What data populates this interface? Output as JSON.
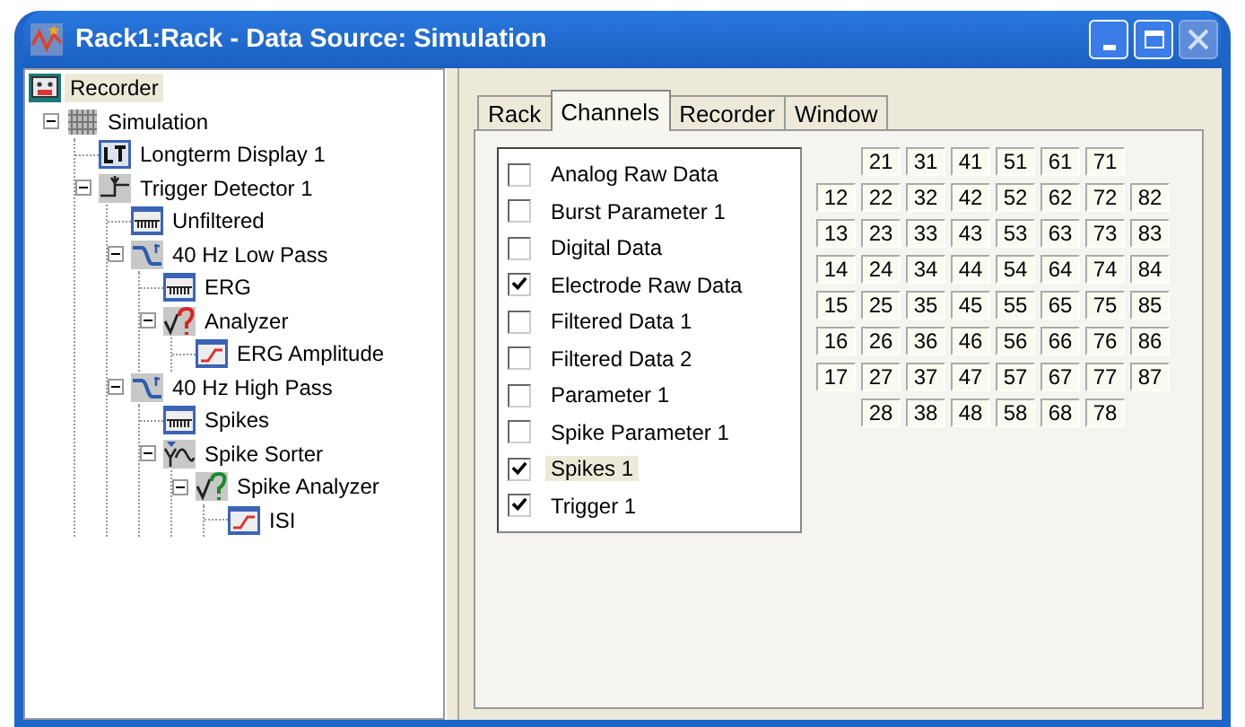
{
  "window": {
    "title": "Rack1:Rack - Data Source: Simulation",
    "buttons": [
      {
        "kind": "minimize",
        "disabled": false
      },
      {
        "kind": "maximize",
        "disabled": false
      },
      {
        "kind": "close",
        "disabled": true
      }
    ]
  },
  "tree": [
    {
      "label": "Recorder",
      "kind": "recorder",
      "selected": true,
      "children": [
        {
          "label": "Simulation",
          "kind": "simulation",
          "selected": false,
          "expanded": true,
          "children": [
            {
              "label": "Longterm Display 1",
              "kind": "display",
              "selected": false
            },
            {
              "label": "Trigger Detector 1",
              "kind": "trigger",
              "selected": false,
              "expanded": true,
              "children": [
                {
                  "label": "Unfiltered",
                  "kind": "signal",
                  "selected": false
                },
                {
                  "label": "40 Hz Low Pass",
                  "kind": "filter",
                  "selected": false,
                  "expanded": true,
                  "children": [
                    {
                      "label": "ERG",
                      "kind": "signal",
                      "selected": false
                    },
                    {
                      "label": "Analyzer",
                      "kind": "analyzer",
                      "selected": false,
                      "expanded": true,
                      "children": [
                        {
                          "label": "ERG Amplitude",
                          "kind": "graph",
                          "selected": false
                        }
                      ]
                    }
                  ]
                },
                {
                  "label": "40 Hz High Pass",
                  "kind": "filter",
                  "selected": false,
                  "expanded": true,
                  "children": [
                    {
                      "label": "Spikes",
                      "kind": "signal",
                      "selected": false
                    },
                    {
                      "label": "Spike Sorter",
                      "kind": "sorter",
                      "selected": false,
                      "expanded": true,
                      "children": [
                        {
                          "label": "Spike Analyzer",
                          "kind": "spike-analyzer",
                          "selected": false,
                          "expanded": true,
                          "children": [
                            {
                              "label": "ISI",
                              "kind": "graph",
                              "selected": false
                            }
                          ]
                        }
                      ]
                    }
                  ]
                }
              ]
            }
          ]
        }
      ]
    }
  ],
  "tabs": [
    {
      "label": "Rack",
      "selected": false
    },
    {
      "label": "Channels",
      "selected": true
    },
    {
      "label": "Recorder",
      "selected": false
    },
    {
      "label": "Window",
      "selected": false
    }
  ],
  "channels": [
    {
      "label": "Analog Raw Data",
      "checked": false,
      "selected": false
    },
    {
      "label": "Burst Parameter 1",
      "checked": false,
      "selected": false
    },
    {
      "label": "Digital Data",
      "checked": false,
      "selected": false
    },
    {
      "label": "Electrode Raw Data",
      "checked": true,
      "selected": false
    },
    {
      "label": "Filtered Data 1",
      "checked": false,
      "selected": false
    },
    {
      "label": "Filtered Data 2",
      "checked": false,
      "selected": false
    },
    {
      "label": "Parameter 1",
      "checked": false,
      "selected": false
    },
    {
      "label": "Spike Parameter 1",
      "checked": false,
      "selected": false
    },
    {
      "label": "Spikes 1",
      "checked": true,
      "selected": true
    },
    {
      "label": "Trigger 1",
      "checked": true,
      "selected": false
    }
  ],
  "electrode_columns": [
    [
      "12",
      "13",
      "14",
      "15",
      "16",
      "17"
    ],
    [
      "21",
      "22",
      "23",
      "24",
      "25",
      "26",
      "27",
      "28"
    ],
    [
      "31",
      "32",
      "33",
      "34",
      "35",
      "36",
      "37",
      "38"
    ],
    [
      "41",
      "42",
      "43",
      "44",
      "45",
      "46",
      "47",
      "48"
    ],
    [
      "51",
      "52",
      "53",
      "54",
      "55",
      "56",
      "57",
      "58"
    ],
    [
      "61",
      "62",
      "63",
      "64",
      "65",
      "66",
      "67",
      "68"
    ],
    [
      "71",
      "72",
      "73",
      "74",
      "75",
      "76",
      "77",
      "78"
    ],
    [
      "82",
      "83",
      "84",
      "85",
      "86",
      "87"
    ]
  ]
}
